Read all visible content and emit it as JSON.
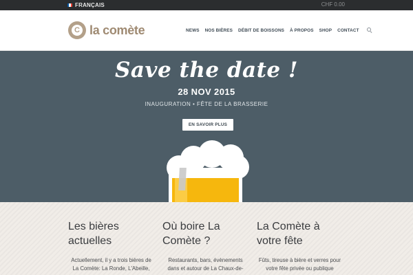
{
  "topbar": {
    "language": "FRANÇAIS",
    "flag_colors": [
      "#0055a4",
      "#ffffff",
      "#ef4135"
    ],
    "cart": "CHF 0.00"
  },
  "header": {
    "logo_text": "la comète",
    "logo_mark_letter": "C",
    "nav": [
      "NEWS",
      "NOS BIÈRES",
      "DÉBIT DE BOISSONS",
      "À PROPOS",
      "SHOP",
      "CONTACT"
    ]
  },
  "hero": {
    "script_title": "Save the date !",
    "date": "28 NOV 2015",
    "subtitle": "INAUGURATION • FÊTE DE LA BRASSERIE",
    "button": "EN SAVOIR PLUS",
    "background": "#4d5d67",
    "beer_color": "#f6b70d"
  },
  "columns": [
    {
      "title": "Les bières actuelles",
      "text": "Actuellement, il y a trois bières de La Comète: La Ronde, L'Abeille,"
    },
    {
      "title": "Où boire La Comète ?",
      "text": "Restaurants, bars, évènements dans et autour de La Chaux-de-"
    },
    {
      "title": "La Comète à votre fête",
      "text": "Fûts, tireuse à bière et verres pour votre fête privée ou publique"
    }
  ]
}
